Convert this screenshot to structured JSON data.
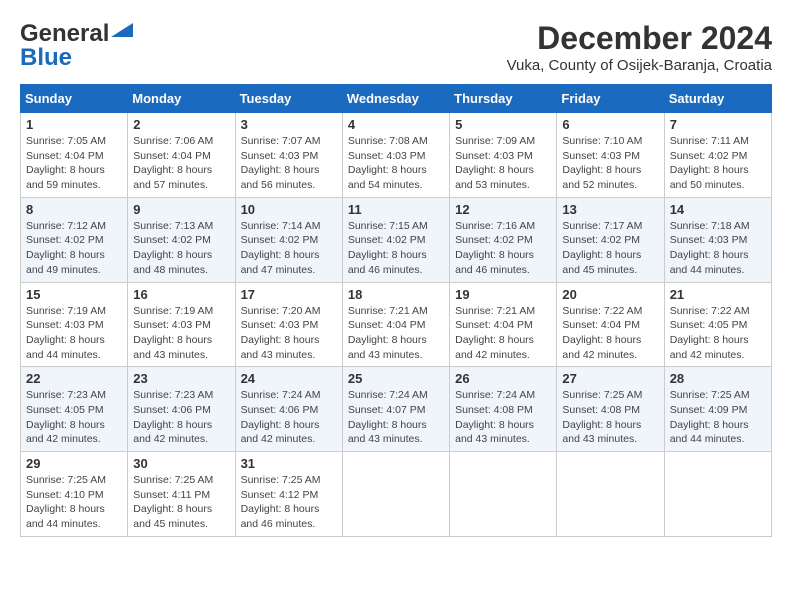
{
  "logo": {
    "line1": "General",
    "line2": "Blue"
  },
  "title": "December 2024",
  "subtitle": "Vuka, County of Osijek-Baranja, Croatia",
  "weekdays": [
    "Sunday",
    "Monday",
    "Tuesday",
    "Wednesday",
    "Thursday",
    "Friday",
    "Saturday"
  ],
  "weeks": [
    [
      {
        "day": 1,
        "sunrise": "7:05 AM",
        "sunset": "4:04 PM",
        "daylight": "8 hours and 59 minutes."
      },
      {
        "day": 2,
        "sunrise": "7:06 AM",
        "sunset": "4:04 PM",
        "daylight": "8 hours and 57 minutes."
      },
      {
        "day": 3,
        "sunrise": "7:07 AM",
        "sunset": "4:03 PM",
        "daylight": "8 hours and 56 minutes."
      },
      {
        "day": 4,
        "sunrise": "7:08 AM",
        "sunset": "4:03 PM",
        "daylight": "8 hours and 54 minutes."
      },
      {
        "day": 5,
        "sunrise": "7:09 AM",
        "sunset": "4:03 PM",
        "daylight": "8 hours and 53 minutes."
      },
      {
        "day": 6,
        "sunrise": "7:10 AM",
        "sunset": "4:03 PM",
        "daylight": "8 hours and 52 minutes."
      },
      {
        "day": 7,
        "sunrise": "7:11 AM",
        "sunset": "4:02 PM",
        "daylight": "8 hours and 50 minutes."
      }
    ],
    [
      {
        "day": 8,
        "sunrise": "7:12 AM",
        "sunset": "4:02 PM",
        "daylight": "8 hours and 49 minutes."
      },
      {
        "day": 9,
        "sunrise": "7:13 AM",
        "sunset": "4:02 PM",
        "daylight": "8 hours and 48 minutes."
      },
      {
        "day": 10,
        "sunrise": "7:14 AM",
        "sunset": "4:02 PM",
        "daylight": "8 hours and 47 minutes."
      },
      {
        "day": 11,
        "sunrise": "7:15 AM",
        "sunset": "4:02 PM",
        "daylight": "8 hours and 46 minutes."
      },
      {
        "day": 12,
        "sunrise": "7:16 AM",
        "sunset": "4:02 PM",
        "daylight": "8 hours and 46 minutes."
      },
      {
        "day": 13,
        "sunrise": "7:17 AM",
        "sunset": "4:02 PM",
        "daylight": "8 hours and 45 minutes."
      },
      {
        "day": 14,
        "sunrise": "7:18 AM",
        "sunset": "4:03 PM",
        "daylight": "8 hours and 44 minutes."
      }
    ],
    [
      {
        "day": 15,
        "sunrise": "7:19 AM",
        "sunset": "4:03 PM",
        "daylight": "8 hours and 44 minutes."
      },
      {
        "day": 16,
        "sunrise": "7:19 AM",
        "sunset": "4:03 PM",
        "daylight": "8 hours and 43 minutes."
      },
      {
        "day": 17,
        "sunrise": "7:20 AM",
        "sunset": "4:03 PM",
        "daylight": "8 hours and 43 minutes."
      },
      {
        "day": 18,
        "sunrise": "7:21 AM",
        "sunset": "4:04 PM",
        "daylight": "8 hours and 43 minutes."
      },
      {
        "day": 19,
        "sunrise": "7:21 AM",
        "sunset": "4:04 PM",
        "daylight": "8 hours and 42 minutes."
      },
      {
        "day": 20,
        "sunrise": "7:22 AM",
        "sunset": "4:04 PM",
        "daylight": "8 hours and 42 minutes."
      },
      {
        "day": 21,
        "sunrise": "7:22 AM",
        "sunset": "4:05 PM",
        "daylight": "8 hours and 42 minutes."
      }
    ],
    [
      {
        "day": 22,
        "sunrise": "7:23 AM",
        "sunset": "4:05 PM",
        "daylight": "8 hours and 42 minutes."
      },
      {
        "day": 23,
        "sunrise": "7:23 AM",
        "sunset": "4:06 PM",
        "daylight": "8 hours and 42 minutes."
      },
      {
        "day": 24,
        "sunrise": "7:24 AM",
        "sunset": "4:06 PM",
        "daylight": "8 hours and 42 minutes."
      },
      {
        "day": 25,
        "sunrise": "7:24 AM",
        "sunset": "4:07 PM",
        "daylight": "8 hours and 43 minutes."
      },
      {
        "day": 26,
        "sunrise": "7:24 AM",
        "sunset": "4:08 PM",
        "daylight": "8 hours and 43 minutes."
      },
      {
        "day": 27,
        "sunrise": "7:25 AM",
        "sunset": "4:08 PM",
        "daylight": "8 hours and 43 minutes."
      },
      {
        "day": 28,
        "sunrise": "7:25 AM",
        "sunset": "4:09 PM",
        "daylight": "8 hours and 44 minutes."
      }
    ],
    [
      {
        "day": 29,
        "sunrise": "7:25 AM",
        "sunset": "4:10 PM",
        "daylight": "8 hours and 44 minutes."
      },
      {
        "day": 30,
        "sunrise": "7:25 AM",
        "sunset": "4:11 PM",
        "daylight": "8 hours and 45 minutes."
      },
      {
        "day": 31,
        "sunrise": "7:25 AM",
        "sunset": "4:12 PM",
        "daylight": "8 hours and 46 minutes."
      },
      null,
      null,
      null,
      null
    ]
  ]
}
